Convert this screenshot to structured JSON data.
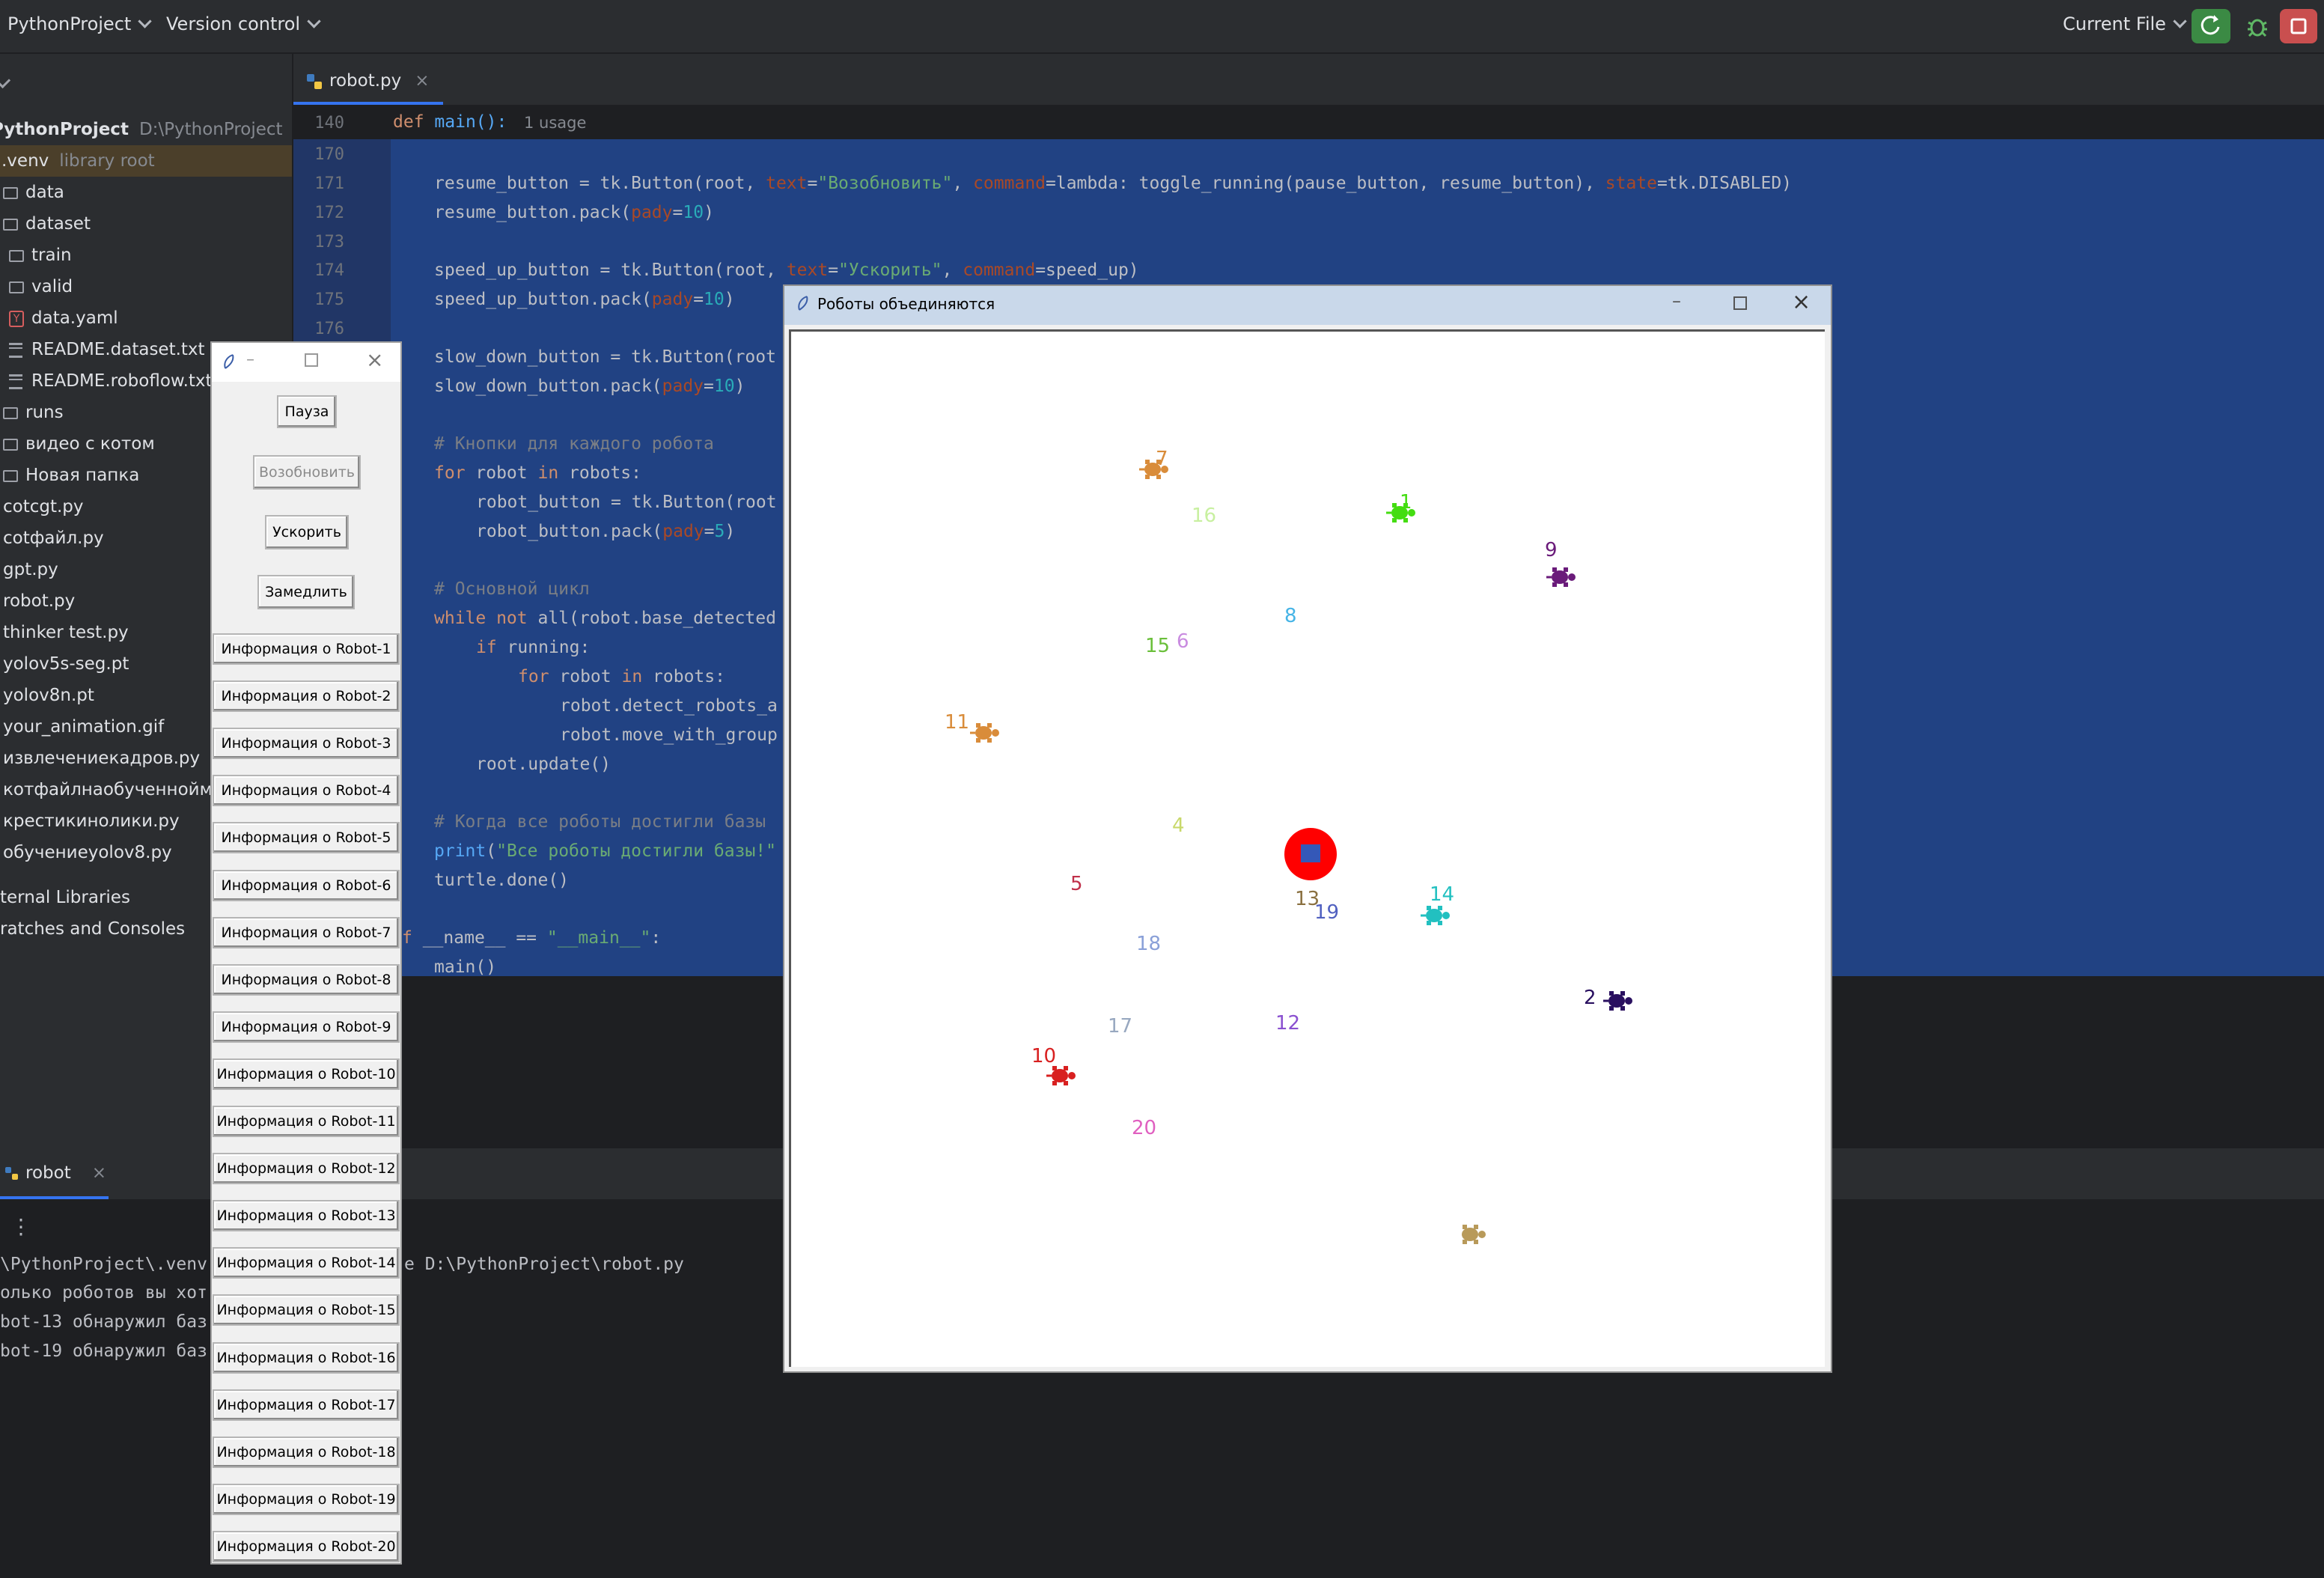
{
  "toolbar": {
    "project": "PythonProject",
    "vcs": "Version control",
    "run_config": "Current File"
  },
  "project_tree": {
    "root_name": "PythonProject",
    "root_path": "D:\\PythonProject",
    "venv_name": ".venv",
    "venv_note": "library root",
    "items": [
      {
        "label": "data",
        "icon": "folder-icon"
      },
      {
        "label": "dataset",
        "icon": "folder-icon"
      },
      {
        "label": "train",
        "icon": "folder-icon"
      },
      {
        "label": "valid",
        "icon": "folder-icon"
      },
      {
        "label": "data.yaml",
        "icon": "yaml-icon"
      },
      {
        "label": "README.dataset.txt",
        "icon": "text-file-icon"
      },
      {
        "label": "README.roboflow.txt",
        "icon": "text-file-icon"
      },
      {
        "label": "runs",
        "icon": "folder-icon"
      },
      {
        "label": "видео с котом",
        "icon": "folder-icon"
      },
      {
        "label": "Новая папка",
        "icon": "folder-icon"
      },
      {
        "label": "cotcgt.py",
        "icon": "python-file-icon"
      },
      {
        "label": "cotфайл.py",
        "icon": "python-file-icon"
      },
      {
        "label": "gpt.py",
        "icon": "python-file-icon"
      },
      {
        "label": "robot.py",
        "icon": "python-file-icon"
      },
      {
        "label": "thinker test.py",
        "icon": "python-file-icon"
      },
      {
        "label": "yolov5s-seg.pt",
        "icon": "file-icon"
      },
      {
        "label": "yolov8n.pt",
        "icon": "file-icon"
      },
      {
        "label": "your_animation.gif",
        "icon": "image-file-icon"
      },
      {
        "label": "извлечениекадров.py",
        "icon": "python-file-icon"
      },
      {
        "label": "котфайлнаобученноймо",
        "icon": "python-file-icon"
      },
      {
        "label": "крестикинолики.py",
        "icon": "python-file-icon"
      },
      {
        "label": "обучениеyolov8.py",
        "icon": "python-file-icon"
      }
    ],
    "external": "ternal Libraries",
    "scratches": "ratches and Consoles"
  },
  "editor": {
    "tab": "robot.py",
    "sticky_line": "140",
    "sticky_def": "def",
    "sticky_fn": "main():",
    "sticky_usage": "1 usage",
    "line_numbers": [
      "170",
      "171",
      "172",
      "173",
      "174",
      "175",
      "176"
    ]
  },
  "run_panel": {
    "tab": "robot",
    "lines": [
      "\\PythonProject\\.venv",
      "олько роботов вы хот",
      "bot-13 обнаружил баз",
      "bot-19 обнаружил баз"
    ],
    "path_fragment": "e D:\\PythonProject\\robot.py"
  },
  "control_window": {
    "pause": "Пауза",
    "resume": "Возобновить",
    "speed_up": "Ускорить",
    "slow_down": "Замедлить",
    "robot_buttons": [
      "Информация о Robot-1",
      "Информация о Robot-2",
      "Информация о Robot-3",
      "Информация о Robot-4",
      "Информация о Robot-5",
      "Информация о Robot-6",
      "Информация о Robot-7",
      "Информация о Robot-8",
      "Информация о Robot-9",
      "Информация о Robot-10",
      "Информация о Robot-11",
      "Информация о Robot-12",
      "Информация о Robot-13",
      "Информация о Robot-14",
      "Информация о Robot-15",
      "Информация о Robot-16",
      "Информация о Robot-17",
      "Информация о Robot-18",
      "Информация о Robot-19",
      "Информация о Robot-20"
    ]
  },
  "turtle_window": {
    "title": "Роботы объединяются",
    "robots": [
      {
        "label": "7",
        "color": "#d98c3a",
        "turtle": true
      },
      {
        "label": "1",
        "color": "#44dd11",
        "turtle": true
      },
      {
        "label": "16",
        "color": "#c8f0a0",
        "turtle": false
      },
      {
        "label": "9",
        "color": "#6a1b7a",
        "turtle": true
      },
      {
        "label": "8",
        "color": "#46b4e6",
        "turtle": false
      },
      {
        "label": "15",
        "color": "#6abf3a",
        "turtle": false
      },
      {
        "label": "6",
        "color": "#c98be0",
        "turtle": false
      },
      {
        "label": "11",
        "color": "#d98c3a",
        "turtle": true
      },
      {
        "label": "4",
        "color": "#c8d86a",
        "turtle": false
      },
      {
        "label": "5",
        "color": "#c0304a",
        "turtle": false
      },
      {
        "label": "13",
        "color": "#8a7040",
        "turtle": false
      },
      {
        "label": "19",
        "color": "#5060c0",
        "turtle": false
      },
      {
        "label": "14",
        "color": "#22c0c0",
        "turtle": true
      },
      {
        "label": "18",
        "color": "#8aa0d8",
        "turtle": false
      },
      {
        "label": "2",
        "color": "#2a1060",
        "turtle": true
      },
      {
        "label": "17",
        "color": "#98a8c0",
        "turtle": false
      },
      {
        "label": "12",
        "color": "#8a50d0",
        "turtle": false
      },
      {
        "label": "10",
        "color": "#d82020",
        "turtle": true
      },
      {
        "label": "20",
        "color": "#e060c0",
        "turtle": false
      }
    ]
  },
  "colors": {
    "accent": "#214283",
    "base": "#ff0000",
    "run_green": "#4caf50",
    "stop_red": "#c94f4f"
  }
}
